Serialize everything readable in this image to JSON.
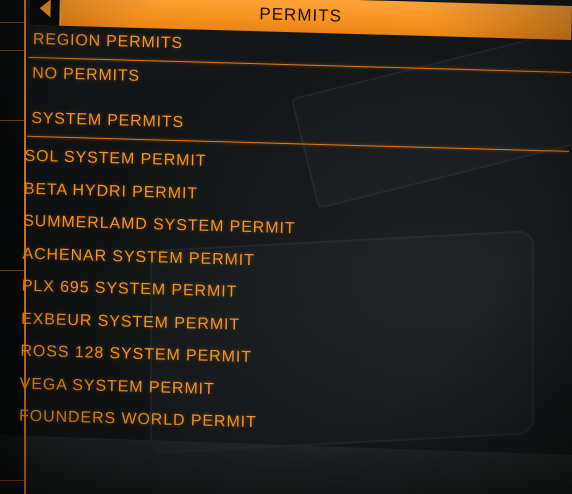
{
  "panel": {
    "title": "PERMITS",
    "back_icon": "chevron-left-icon",
    "accent_color": "#f7931f"
  },
  "region": {
    "heading": "REGION PERMITS",
    "empty_text": "NO PERMITS"
  },
  "system": {
    "heading": "SYSTEM PERMITS",
    "items": [
      "SOL SYSTEM PERMIT",
      "BETA HYDRI PERMIT",
      "SUMMERLAMD SYSTEM PERMIT",
      "ACHENAR SYSTEM PERMIT",
      "PLX 695 SYSTEM PERMIT",
      "EXBEUR SYSTEM PERMIT",
      "ROSS 128 SYSTEM PERMIT",
      "VEGA SYSTEM PERMIT",
      "FOUNDERS WORLD PERMIT"
    ]
  }
}
